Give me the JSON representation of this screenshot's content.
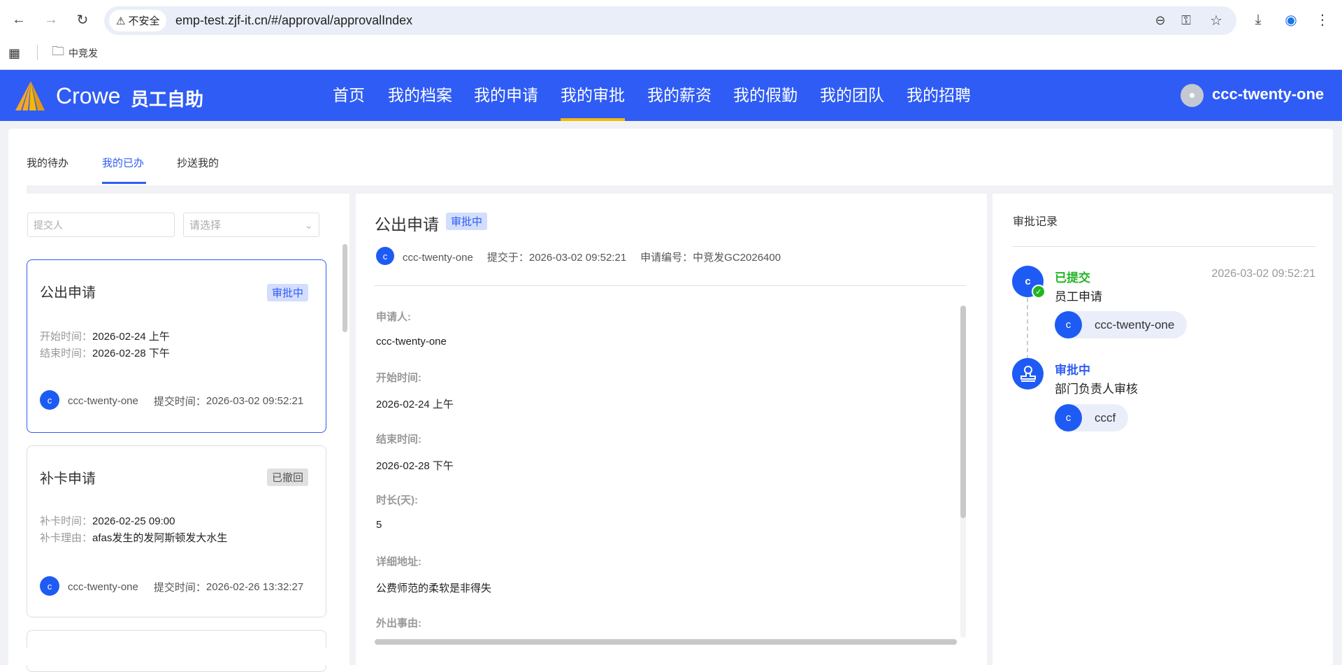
{
  "browser": {
    "security_label": "不安全",
    "url": "emp-test.zjf-it.cn/#/approval/approvalIndex",
    "bookmark_folder": "中竞发"
  },
  "header": {
    "brand": "Crowe",
    "app_title": "员工自助",
    "nav": [
      "首页",
      "我的档案",
      "我的申请",
      "我的审批",
      "我的薪资",
      "我的假勤",
      "我的团队",
      "我的招聘"
    ],
    "active_nav": "我的审批",
    "user": "ccc-twenty-one"
  },
  "tabs": [
    "我的待办",
    "我的已办",
    "抄送我的"
  ],
  "filters": {
    "submitter_placeholder": "提交人",
    "select_placeholder": "请选择"
  },
  "list": [
    {
      "title": "公出申请",
      "status": "审批中",
      "lines": [
        {
          "k": "开始时间：",
          "v": "2026-02-24 上午"
        },
        {
          "k": "结束时间：",
          "v": "2026-02-28 下午"
        }
      ],
      "avatar": "c",
      "user": "ccc-twenty-one",
      "submit_label": "提交时间：",
      "submit_time": "2026-03-02 09:52:21"
    },
    {
      "title": "补卡申请",
      "status": "已撤回",
      "lines": [
        {
          "k": "补卡时间：",
          "v": "2026-02-25 09:00"
        },
        {
          "k": "补卡理由：",
          "v": "afas发生的发阿斯顿发大水生"
        }
      ],
      "avatar": "c",
      "user": "ccc-twenty-one",
      "submit_label": "提交时间：",
      "submit_time": "2026-02-26 13:32:27"
    }
  ],
  "detail": {
    "title": "公出申请",
    "status": "审批中",
    "avatar": "c",
    "user": "ccc-twenty-one",
    "submitted": "提交于：2026-03-02 09:52:21",
    "number": "申请编号：中竞发GC2026400",
    "fields": [
      {
        "label": "申请人:",
        "value": "ccc-twenty-one"
      },
      {
        "label": "开始时间:",
        "value": "2026-02-24 上午"
      },
      {
        "label": "结束时间:",
        "value": "2026-02-28 下午"
      },
      {
        "label": "时长(天):",
        "value": "5"
      },
      {
        "label": "详细地址:",
        "value": "公费师范的柔软是非得失"
      },
      {
        "label": "外出事由:",
        "value": ""
      }
    ]
  },
  "record": {
    "title": "审批记录",
    "steps": [
      {
        "status": "已提交",
        "name": "员工申请",
        "time": "2026-03-02 09:52:21",
        "avatar": "c",
        "person_avatar": "c",
        "person": "ccc-twenty-one",
        "color": "#22b522"
      },
      {
        "status": "审批中",
        "name": "部门负责人审核",
        "person_avatar": "c",
        "person": "cccf",
        "color": "#2f5cf5"
      }
    ]
  }
}
